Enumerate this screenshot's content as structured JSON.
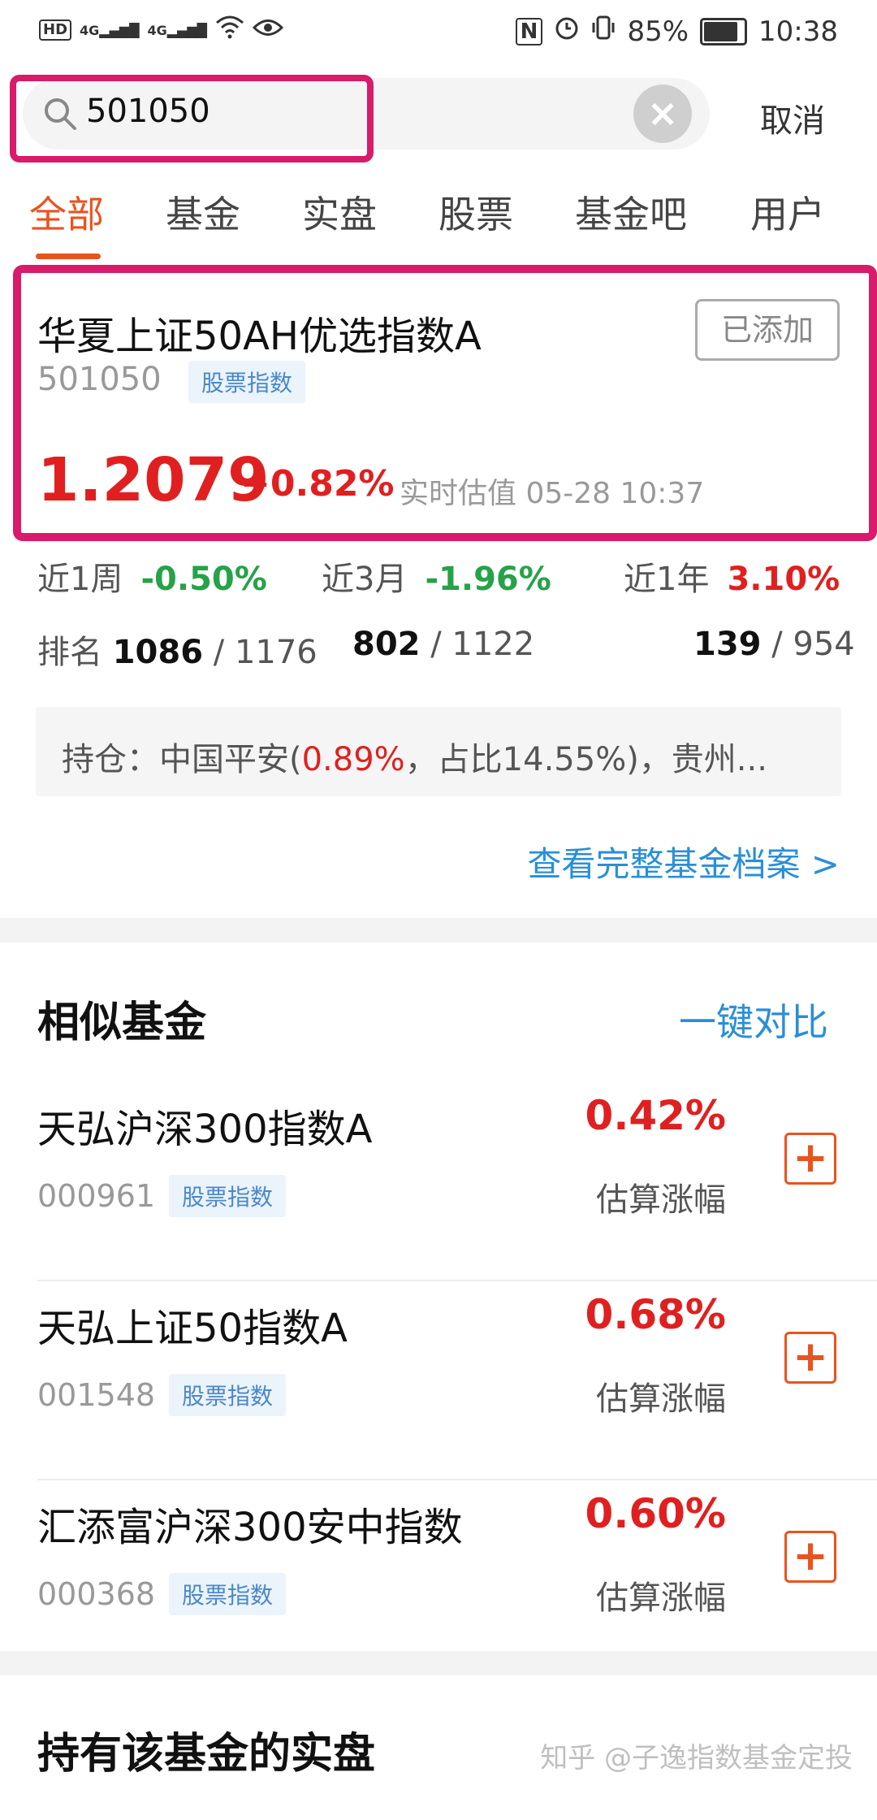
{
  "status_bar": {
    "left_icons": [
      "HD",
      "4G",
      "4G",
      "wifi-icon",
      "eye-icon"
    ],
    "battery": "85%",
    "time": "10:38"
  },
  "search": {
    "value": "501050",
    "cancel_label": "取消"
  },
  "tabs": [
    "全部",
    "基金",
    "实盘",
    "股票",
    "基金吧",
    "用户"
  ],
  "fund": {
    "name": "华夏上证50AH优选指数A",
    "code": "501050",
    "tag": "股票指数",
    "added_label": "已添加",
    "nav": "1.2079",
    "change": "+0.82%",
    "estimate_label": "实时估值 05-28 10:37"
  },
  "performance": [
    {
      "label": "近1周",
      "value": "-0.50%",
      "rank": "1086",
      "total": "1176"
    },
    {
      "label": "近3月",
      "value": "-1.96%",
      "rank": "802",
      "total": "1122"
    },
    {
      "label": "近1年",
      "value": "3.10%",
      "rank": "139",
      "total": "954"
    }
  ],
  "rank_label": "排名",
  "holdings": {
    "prefix": "持仓：中国平安(",
    "pct": "0.89%",
    "suffix": "，占比14.55%)，贵州..."
  },
  "profile_link": "查看完整基金档案 >",
  "similar": {
    "title": "相似基金",
    "compare_label": "一键对比",
    "rate_label": "估算涨幅",
    "items": [
      {
        "name": "天弘沪深300指数A",
        "code": "000961",
        "tag": "股票指数",
        "rate": "0.42%"
      },
      {
        "name": "天弘上证50指数A",
        "code": "001548",
        "tag": "股票指数",
        "rate": "0.68%"
      },
      {
        "name": "汇添富沪深300安中指数",
        "code": "000368",
        "tag": "股票指数",
        "rate": "0.60%"
      }
    ]
  },
  "holders_title": "持有该基金的实盘",
  "watermark": "知乎 @子逸指数基金定投",
  "colors": {
    "accent": "#e8541e",
    "up": "#e02020",
    "down": "#26a248",
    "link": "#2a8fd6",
    "highlight": "#d81b6a"
  }
}
